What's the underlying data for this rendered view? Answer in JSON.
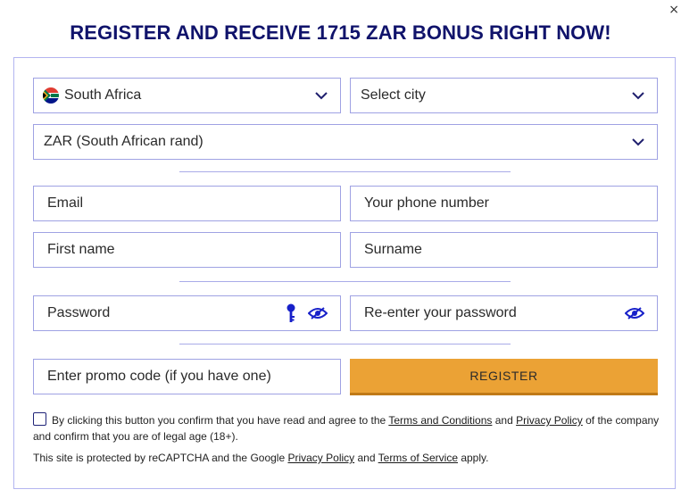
{
  "close_label": "×",
  "title": "REGISTER AND RECEIVE 1715 ZAR BONUS RIGHT NOW!",
  "form": {
    "country": {
      "value": "South Africa",
      "flag": "south-africa-flag"
    },
    "city": {
      "placeholder": "Select city"
    },
    "currency": {
      "value": "ZAR (South African rand)"
    },
    "email": {
      "placeholder": "Email"
    },
    "phone": {
      "placeholder": "Your phone number"
    },
    "first_name": {
      "placeholder": "First name"
    },
    "surname": {
      "placeholder": "Surname"
    },
    "password": {
      "placeholder": "Password",
      "key_icon": "key-icon",
      "toggle_icon": "eye-slash-icon"
    },
    "password_repeat": {
      "placeholder": "Re-enter your password",
      "toggle_icon": "eye-slash-icon"
    },
    "promo": {
      "placeholder": "Enter promo code (if you have one)"
    },
    "register_label": "REGISTER"
  },
  "consent": {
    "text_before": "By clicking this button you confirm that you have read and agree to the ",
    "terms_link": "Terms and Conditions",
    "and_1": " and ",
    "privacy_link": "Privacy Policy",
    "text_after": " of the company and confirm that you are of legal age (18+)."
  },
  "recaptcha": {
    "text_before": "This site is protected by reCAPTCHA and the Google ",
    "privacy_link": "Privacy Policy",
    "and": " and ",
    "terms_link": "Terms of Service",
    "text_after": " apply."
  },
  "colors": {
    "title": "#10136b",
    "border": "#9fa2e3",
    "register_button": "#eba235",
    "icon_blue": "#1720c9"
  }
}
